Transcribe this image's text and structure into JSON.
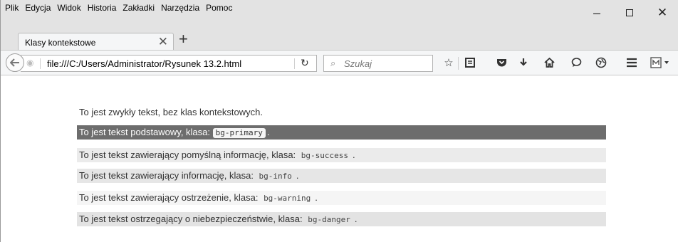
{
  "menu": {
    "items": [
      "Plik",
      "Edycja",
      "Widok",
      "Historia",
      "Zakładki",
      "Narzędzia",
      "Pomoc"
    ]
  },
  "window_controls": {
    "minimize": "–",
    "close": "✕"
  },
  "tab": {
    "title": "Klasy kontekstowe",
    "close": "✕",
    "new_tab": "+"
  },
  "navbar": {
    "url": "file:///C:/Users/Administrator/Rysunek 13.2.html",
    "search_placeholder": "Szukaj"
  },
  "content": {
    "plain": "To jest zwykły tekst, bez klas kontekstowych.",
    "primary": {
      "text": "To jest tekst podstawowy, klasa: ",
      "code": "bg-primary",
      "after": "."
    },
    "success": {
      "text": "To jest tekst zawierający pomyślną informację, klasa: ",
      "code": "bg-success",
      "after": "."
    },
    "info": {
      "text": "To jest tekst zawierający informację, klasa: ",
      "code": "bg-info",
      "after": "."
    },
    "warning": {
      "text": "To jest tekst zawierający ostrzeżenie, klasa: ",
      "code": "bg-warning",
      "after": "."
    },
    "danger": {
      "text": "To jest tekst ostrzegający o niebezpieczeństwie, klasa: ",
      "code": "bg-danger",
      "after": "."
    }
  },
  "colors": {
    "primary_bg": "#6d6d6d",
    "success_bg": "#ebebeb",
    "info_bg": "#e6e6e6",
    "warning_bg": "#f5f5f5",
    "danger_bg": "#e3e3e3"
  }
}
